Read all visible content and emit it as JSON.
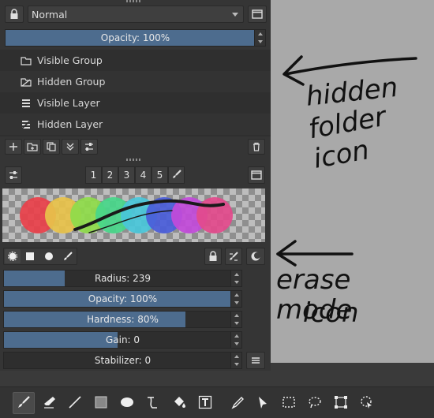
{
  "blend_mode": {
    "value": "Normal"
  },
  "opacity_slider": {
    "label": "Opacity: 100%",
    "fraction": 1.0
  },
  "layers": [
    {
      "name": "Visible Group",
      "icon": "folder-icon"
    },
    {
      "name": "Hidden Group",
      "icon": "hidden-folder-icon"
    },
    {
      "name": "Visible Layer",
      "icon": "layer-icon"
    },
    {
      "name": "Hidden Layer",
      "icon": "hidden-layer-icon"
    }
  ],
  "brush_tabs": [
    "1",
    "2",
    "3",
    "4",
    "5"
  ],
  "brush_sliders": [
    {
      "label": "Radius: 239",
      "fraction": 0.27
    },
    {
      "label": "Opacity: 100%",
      "fraction": 1.0
    },
    {
      "label": "Hardness: 80%",
      "fraction": 0.8
    },
    {
      "label": "Gain: 0",
      "fraction": 0.5
    },
    {
      "label": "Stabilizer: 0",
      "fraction": 0.0
    }
  ],
  "preview_colors": [
    "#e8414a",
    "#e7c24a",
    "#8fdc4a",
    "#48d68a",
    "#49c6d9",
    "#4a5ed9",
    "#c24ad9",
    "#e24a8c"
  ],
  "annotations": {
    "hidden_folder": [
      "hidden",
      "folder icon"
    ],
    "erase_mode": [
      "erase mode",
      "icon"
    ]
  },
  "colors": {
    "accent": "#4d6c8e",
    "panel": "#353535",
    "canvas": "#a9a9a9"
  }
}
